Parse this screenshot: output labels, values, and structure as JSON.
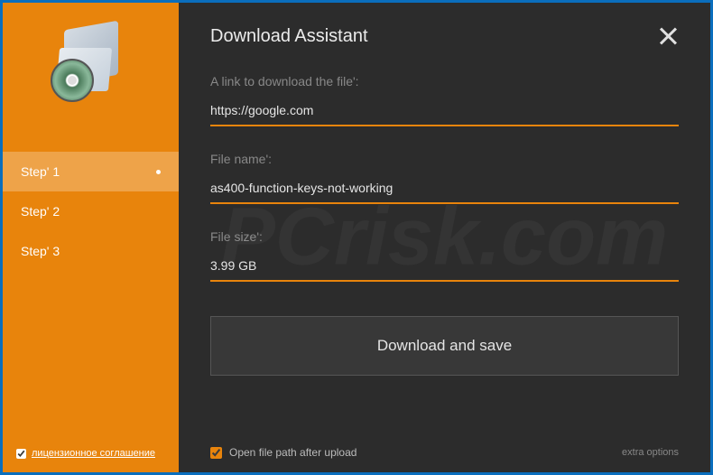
{
  "sidebar": {
    "steps": [
      {
        "label": "Step' 1",
        "active": true
      },
      {
        "label": "Step' 2",
        "active": false
      },
      {
        "label": "Step' 3",
        "active": false
      }
    ],
    "license": {
      "checked": true,
      "label": "лицензионное соглашение"
    }
  },
  "header": {
    "title": "Download Assistant"
  },
  "fields": {
    "link": {
      "label": "A link to download the file':",
      "value": "https://google.com"
    },
    "filename": {
      "label": "File name':",
      "value": "as400-function-keys-not-working"
    },
    "filesize": {
      "label": "File size':",
      "value": "3.99 GB"
    }
  },
  "actions": {
    "download_label": "Download and save"
  },
  "footer": {
    "open_path_checked": true,
    "open_path_label": "Open file path after upload",
    "extra_options": "extra options"
  },
  "colors": {
    "accent_orange": "#e8840c",
    "border_blue": "#0a6ebd",
    "bg_dark": "#2c2c2c"
  },
  "watermark": "PCrisk.com"
}
